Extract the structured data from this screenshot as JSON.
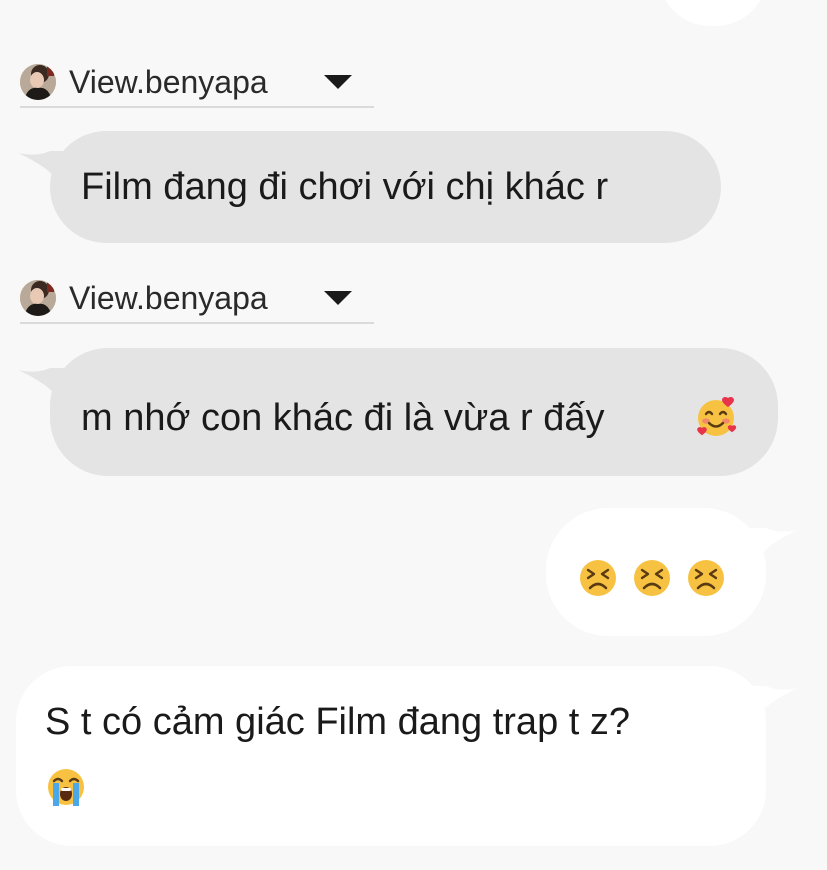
{
  "colors": {
    "background": "#f8f8f8",
    "incoming_bubble": "#e4e4e4",
    "outgoing_bubble": "#ffffff",
    "divider": "#dadada",
    "text": "#1a1a1a"
  },
  "messages": [
    {
      "sender_name": "View.benyapa",
      "text": "Film đang đi chơi với chị khác r"
    },
    {
      "sender_name": "View.benyapa",
      "text": "m nhớ con khác đi là vừa r đấy",
      "emoji": "smiling-face-with-hearts"
    }
  ],
  "outgoing_reaction": {
    "emoji": "persevering-face",
    "count": 3
  },
  "outgoing_message": {
    "text": "S t có cảm giác Film đang trap t z?",
    "emoji": "loudly-crying-face"
  }
}
